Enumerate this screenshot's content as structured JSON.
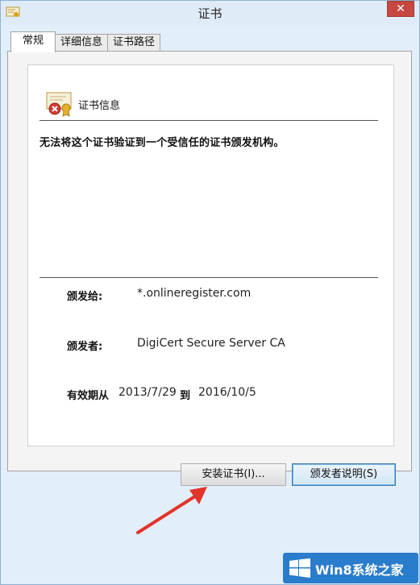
{
  "window": {
    "title": "证书",
    "close_label": "✕"
  },
  "tabs": [
    {
      "label": "常规"
    },
    {
      "label": "详细信息"
    },
    {
      "label": "证书路径"
    }
  ],
  "cert": {
    "heading": "证书信息",
    "message": "无法将这个证书验证到一个受信任的证书颁发机构。",
    "issued_to_label": "颁发给:",
    "issued_to_value": "*.onlineregister.com",
    "issued_by_label": "颁发者:",
    "issued_by_value": "DigiCert Secure Server CA",
    "valid_from_label": "有效期从",
    "valid_from_value": "2013/7/29",
    "valid_to_label": "到",
    "valid_to_value": "2016/10/5"
  },
  "buttons": {
    "install_label": "安装证书(I)...",
    "issuer_statement_label": "颁发者说明(S)"
  },
  "watermark": {
    "text": "Win8系统之家"
  },
  "colors": {
    "accent_arrow": "#e2342b",
    "watermark_bg": "#2a7ccc"
  }
}
